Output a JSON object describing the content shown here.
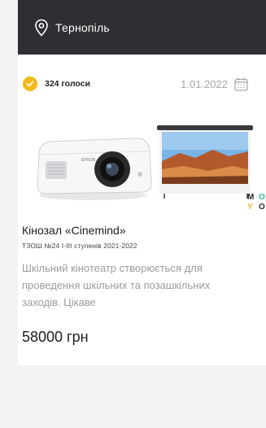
{
  "location": {
    "city": "Тернопіль",
    "icon": "location-pin-icon"
  },
  "card": {
    "votes": "324 голоси",
    "date": "1.01.2022",
    "title": "Кінозал «Cinemind»",
    "subtitle": "ТЗОШ №24 І-ІІІ ступенів 2021-2022",
    "description": "Шкільний кінотеатр створюється для проведення шкільних та позашкільних заходів. Цікаве",
    "price": "58000 грн",
    "image_brand": [
      "M",
      "O",
      "Y",
      "O"
    ],
    "projector_label": "EPSON"
  },
  "colors": {
    "header_bg": "#2f2f33",
    "badge": "#f2b91c",
    "page_bg": "#f2f2f4"
  }
}
